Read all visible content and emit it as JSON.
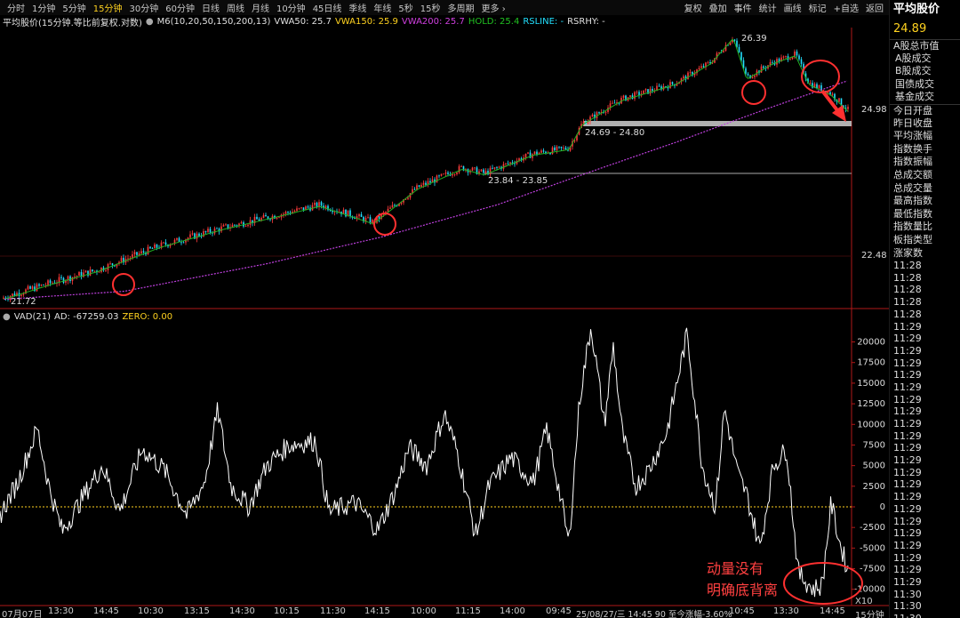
{
  "toolbar": {
    "timeframes": [
      "分时",
      "1分钟",
      "5分钟",
      "15分钟",
      "30分钟",
      "60分钟",
      "日线",
      "周线",
      "月线",
      "10分钟",
      "45日线",
      "季线",
      "年线",
      "5秒",
      "15秒",
      "多周期",
      "更多 ›"
    ],
    "active": "15分钟",
    "tools": [
      "复权",
      "叠加",
      "事件",
      "统计",
      "画线",
      "标记",
      "+自选",
      "返回"
    ]
  },
  "info": {
    "title": "平均股价(15分钟.等比前复权.对数)",
    "ma": "M6(10,20,50,150,200,13)",
    "vwa50": "VWA50: 25.7",
    "vwa150": "VWA150: 25.9",
    "vwa200": "VWA200: 25.7",
    "hold": "HOLD: 25.4",
    "rsline": "RSLINE: -",
    "rsrhy": "RSRHY: -"
  },
  "colors": {
    "up": "#ff3b3b",
    "down": "#22e0ff",
    "hold": "#21b121",
    "vwa": "#c040e0",
    "zero": "#ffd21f",
    "annotation": "#ff3030"
  },
  "price_axis": [
    "24.98",
    "22.48"
  ],
  "vad_axis": [
    "20000",
    "17500",
    "15000",
    "12500",
    "10000",
    "7500",
    "5000",
    "2500",
    "0",
    "-2500",
    "-5000",
    "-7500",
    "-10000"
  ],
  "vad_unit": "X10",
  "indicator": {
    "name": "VAD(21)",
    "ad": "AD: -67259.03",
    "zero": "ZERO: 0.00"
  },
  "annotations": {
    "high": "26.39",
    "low": "21.72",
    "zone1": "24.69 - 24.80",
    "zone2": "23.84 - 23.85",
    "note_line1": "动量没有",
    "note_line2": "明确底背离"
  },
  "time_axis": [
    "07月07日",
    "13:30",
    "14:45",
    "10:30",
    "13:15",
    "14:30",
    "10:15",
    "11:30",
    "14:15",
    "10:00",
    "11:15",
    "14:00",
    "09:45",
    "10:45",
    "13:30",
    "14:45"
  ],
  "status": "25/08/27/三 14:45 90 至今涨幅-3.60%",
  "timeframe_label": "15分钟",
  "sidebar": {
    "title": "平均股价",
    "price": "24.89",
    "items": [
      "A股总市值",
      "A股成交",
      "B股成交",
      "国债成交",
      "基金成交",
      "今日开盘",
      "昨日收盘",
      "平均涨幅",
      "指数换手",
      "指数振幅",
      "总成交额",
      "总成交量",
      "最高指数",
      "最低指数",
      "指数量比",
      "板指类型",
      "涨家数"
    ],
    "times": [
      "11:28",
      "11:28",
      "11:28",
      "11:28",
      "11:28",
      "11:29",
      "11:29",
      "11:29",
      "11:29",
      "11:29",
      "11:29",
      "11:29",
      "11:29",
      "11:29",
      "11:29",
      "11:29",
      "11:29",
      "11:29",
      "11:29",
      "11:29",
      "11:29",
      "11:29",
      "11:29",
      "11:29",
      "11:29",
      "11:29",
      "11:29",
      "11:30",
      "11:30",
      "11:30"
    ]
  },
  "chart_data": {
    "type": "candlestick",
    "price_range": [
      21.6,
      26.5
    ],
    "price_anchors": [
      [
        0,
        21.73
      ],
      [
        60,
        22.0
      ],
      [
        110,
        22.2
      ],
      [
        180,
        22.6
      ],
      [
        250,
        22.9
      ],
      [
        320,
        23.15
      ],
      [
        360,
        23.3
      ],
      [
        420,
        23.0
      ],
      [
        470,
        23.6
      ],
      [
        520,
        23.95
      ],
      [
        545,
        23.85
      ],
      [
        600,
        24.2
      ],
      [
        640,
        24.3
      ],
      [
        655,
        24.75
      ],
      [
        700,
        25.2
      ],
      [
        760,
        25.5
      ],
      [
        800,
        25.9
      ],
      [
        825,
        26.39
      ],
      [
        840,
        25.6
      ],
      [
        870,
        25.9
      ],
      [
        895,
        26.05
      ],
      [
        910,
        25.5
      ],
      [
        935,
        25.3
      ],
      [
        955,
        24.98
      ]
    ],
    "vwa_anchors": [
      [
        5,
        21.72
      ],
      [
        140,
        21.85
      ],
      [
        300,
        22.3
      ],
      [
        430,
        22.75
      ],
      [
        560,
        23.3
      ],
      [
        660,
        23.85
      ],
      [
        760,
        24.4
      ],
      [
        860,
        25.0
      ],
      [
        955,
        25.55
      ]
    ],
    "vad_range": [
      -11000,
      22000
    ],
    "vad_anchors": [
      [
        0,
        -1000
      ],
      [
        20,
        3000
      ],
      [
        42,
        9500
      ],
      [
        55,
        2500
      ],
      [
        70,
        -3000
      ],
      [
        95,
        1500
      ],
      [
        115,
        5000
      ],
      [
        135,
        -500
      ],
      [
        160,
        7000
      ],
      [
        185,
        4500
      ],
      [
        210,
        -1000
      ],
      [
        230,
        3000
      ],
      [
        245,
        11700
      ],
      [
        260,
        2500
      ],
      [
        280,
        0
      ],
      [
        300,
        5000
      ],
      [
        325,
        7500
      ],
      [
        355,
        8000
      ],
      [
        370,
        -600
      ],
      [
        400,
        500
      ],
      [
        425,
        -2800
      ],
      [
        445,
        2000
      ],
      [
        460,
        7200
      ],
      [
        480,
        5000
      ],
      [
        500,
        11300
      ],
      [
        515,
        6500
      ],
      [
        535,
        -3500
      ],
      [
        550,
        2500
      ],
      [
        575,
        6000
      ],
      [
        600,
        3000
      ],
      [
        615,
        9500
      ],
      [
        630,
        1500
      ],
      [
        640,
        -4500
      ],
      [
        652,
        13000
      ],
      [
        665,
        22000
      ],
      [
        680,
        10000
      ],
      [
        690,
        19500
      ],
      [
        700,
        9000
      ],
      [
        715,
        2500
      ],
      [
        730,
        4500
      ],
      [
        750,
        9000
      ],
      [
        773,
        21000
      ],
      [
        790,
        5000
      ],
      [
        805,
        -100
      ],
      [
        815,
        12000
      ],
      [
        830,
        4000
      ],
      [
        840,
        1500
      ],
      [
        855,
        -5000
      ],
      [
        870,
        5000
      ],
      [
        885,
        7000
      ],
      [
        898,
        -8000
      ],
      [
        915,
        -10000
      ],
      [
        925,
        -9500
      ],
      [
        935,
        500
      ],
      [
        945,
        -4500
      ],
      [
        955,
        -8000
      ]
    ]
  }
}
